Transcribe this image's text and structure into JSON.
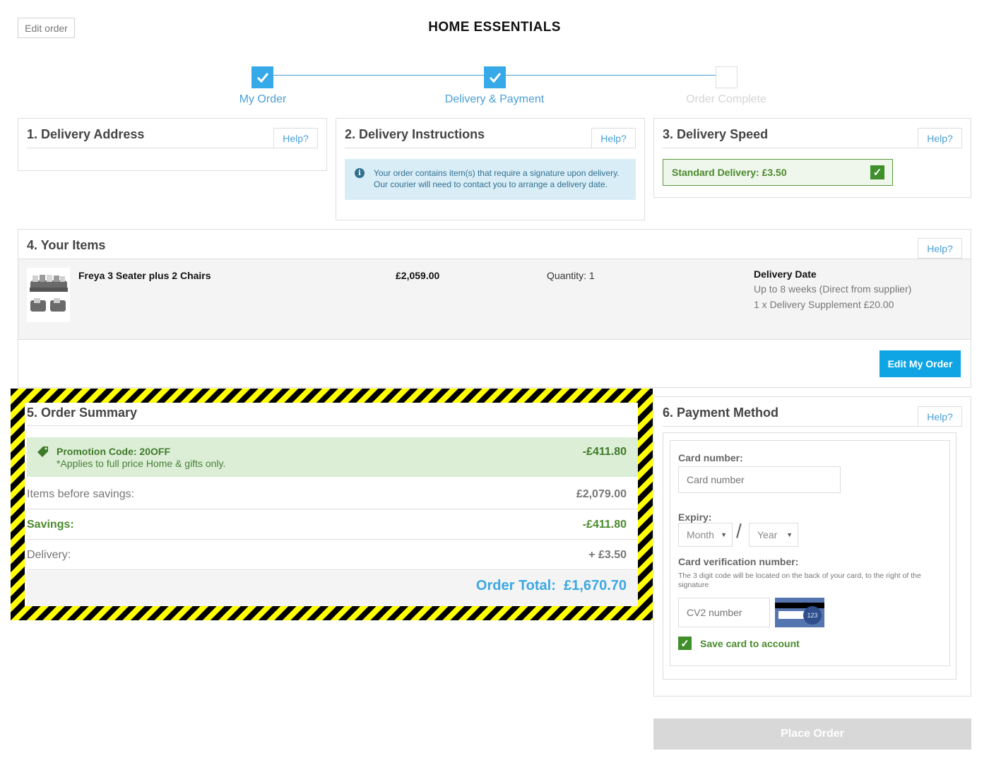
{
  "header": {
    "edit_order_label": "Edit order",
    "brand": "HOME ESSENTIALS"
  },
  "progress": {
    "steps": [
      {
        "label": "My Order",
        "state": "complete"
      },
      {
        "label": "Delivery & Payment",
        "state": "complete"
      },
      {
        "label": "Order Complete",
        "state": "pending"
      }
    ]
  },
  "help_label": "Help?",
  "delivery_address": {
    "title": "1. Delivery Address"
  },
  "delivery_instructions": {
    "title": "2. Delivery Instructions",
    "info_line1": "Your order contains item(s) that require a signature upon delivery.",
    "info_line2": "Our courier will need to contact you to arrange a delivery date."
  },
  "delivery_speed": {
    "title": "3. Delivery Speed",
    "selected_option": "Standard Delivery: £3.50",
    "selected": true
  },
  "your_items": {
    "title": "4. Your Items",
    "items": [
      {
        "name": "Freya 3 Seater plus 2 Chairs",
        "price": "£2,059.00",
        "quantity": "Quantity: 1",
        "delivery_date_heading": "Delivery Date",
        "delivery_date": "Up to 8 weeks (Direct from supplier)",
        "delivery_supplement": "1 x Delivery Supplement £20.00"
      }
    ],
    "edit_button": "Edit My Order"
  },
  "order_summary": {
    "title": "5. Order Summary",
    "promo": {
      "title": "Promotion Code: 20OFF",
      "note": "*Applies to full price Home & gifts only.",
      "amount": "-£411.80"
    },
    "rows": [
      {
        "label": "Items before savings:",
        "value": "£2,079.00"
      },
      {
        "label": "Savings:",
        "value": "-£411.80"
      },
      {
        "label": "Delivery:",
        "value": "+ £3.50"
      }
    ],
    "total_label": "Order Total:",
    "total_value": "£1,670.70"
  },
  "payment": {
    "title": "6. Payment Method",
    "card_number_label": "Card number:",
    "card_number_placeholder": "Card number",
    "card_number_value": "",
    "expiry_label": "Expiry:",
    "month_selected": "Month",
    "year_selected": "Year",
    "cvn_label": "Card verification number:",
    "cvn_help": "The 3 digit code will be located on the back of your card, to the right of the signature",
    "cvn_placeholder": "CV2 number",
    "cvn_value": "",
    "cvv_card_digits": "123",
    "save_card_label": "Save card to account",
    "save_card_checked": true
  },
  "place_order_label": "Place Order",
  "colors": {
    "accent_blue": "#36a9e8",
    "success_green": "#3f8f2a",
    "hazard_yellow": "#ffff00",
    "disabled_grey": "#d8d8d8"
  }
}
